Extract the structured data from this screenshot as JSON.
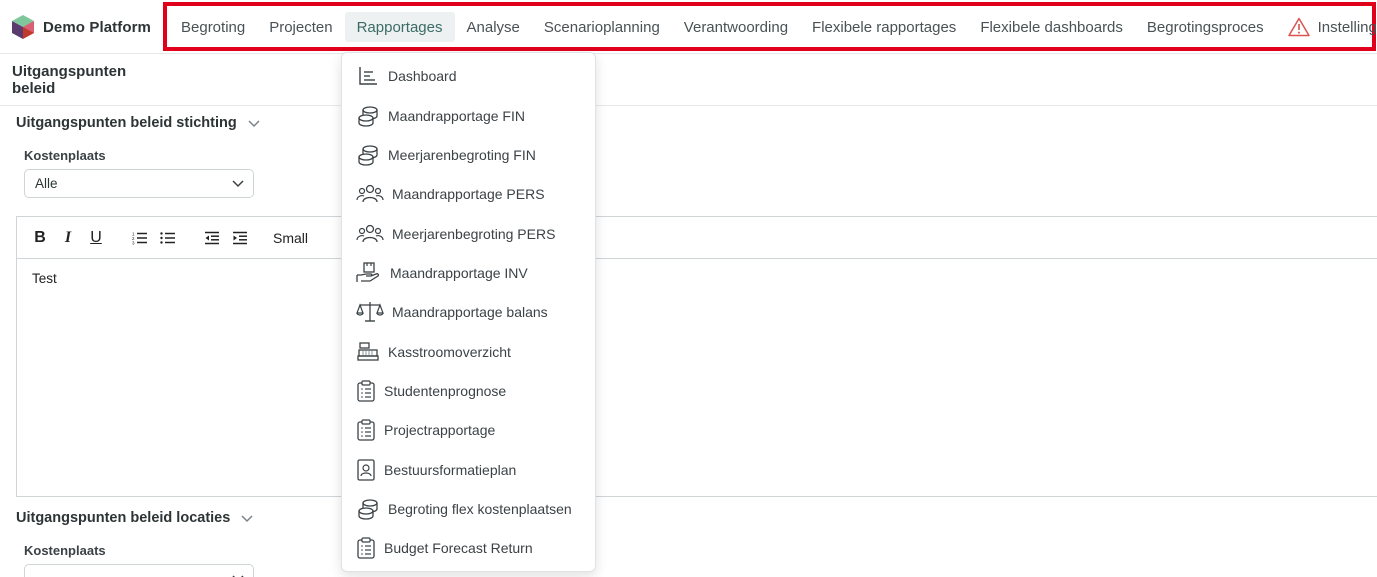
{
  "brand": {
    "name": "Demo Platform"
  },
  "nav": {
    "items": [
      {
        "label": "Begroting"
      },
      {
        "label": "Projecten"
      },
      {
        "label": "Rapportages"
      },
      {
        "label": "Analyse"
      },
      {
        "label": "Scenarioplanning"
      },
      {
        "label": "Verantwoording"
      },
      {
        "label": "Flexibele rapportages"
      },
      {
        "label": "Flexibele dashboards"
      },
      {
        "label": "Begrotingsproces"
      },
      {
        "label": "Instellingen",
        "icon": "warning-icon"
      }
    ],
    "active": "Rapportages"
  },
  "page": {
    "title": "Uitgangspunten beleid"
  },
  "section1": {
    "title": "Uitgangspunten beleid stichting",
    "field_label": "Kostenplaats",
    "select_value": "Alle"
  },
  "editor": {
    "toolbar": {
      "bold": "B",
      "italic": "I",
      "underline": "U",
      "size": "Small"
    },
    "content": "Test"
  },
  "section2": {
    "title": "Uitgangspunten beleid locaties",
    "field_label": "Kostenplaats"
  },
  "dropdown": {
    "items": [
      {
        "label": "Dashboard",
        "icon": "chart-icon"
      },
      {
        "label": "Maandrapportage FIN",
        "icon": "coins-icon"
      },
      {
        "label": "Meerjarenbegroting FIN",
        "icon": "coins-icon"
      },
      {
        "label": "Maandrapportage PERS",
        "icon": "people-icon"
      },
      {
        "label": "Meerjarenbegroting PERS",
        "icon": "people-icon"
      },
      {
        "label": "Maandrapportage INV",
        "icon": "hand-box-icon"
      },
      {
        "label": "Maandrapportage balans",
        "icon": "scale-icon"
      },
      {
        "label": "Kasstroomoverzicht",
        "icon": "cash-register-icon"
      },
      {
        "label": "Studentenprognose",
        "icon": "clipboard-icon"
      },
      {
        "label": "Projectrapportage",
        "icon": "clipboard-icon"
      },
      {
        "label": "Bestuursformatieplan",
        "icon": "id-badge-icon"
      },
      {
        "label": "Begroting flex kostenplaatsen",
        "icon": "coins-icon"
      },
      {
        "label": "Budget Forecast Return",
        "icon": "clipboard-icon"
      }
    ]
  },
  "colors": {
    "accent": "#3c6b67",
    "highlight_border": "#e0001b",
    "warning": "#d9534f"
  }
}
